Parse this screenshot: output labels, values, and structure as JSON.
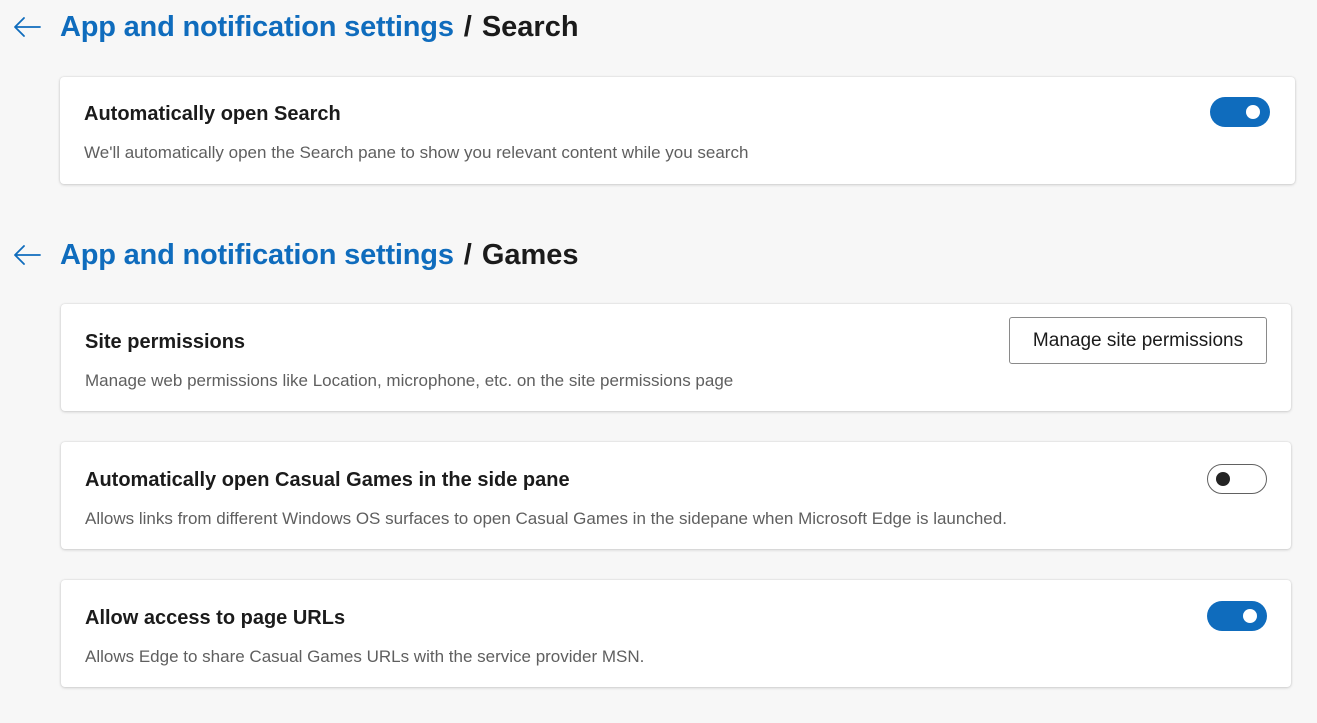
{
  "sections": [
    {
      "breadcrumb_link": "App and notification settings",
      "breadcrumb_sep": "/",
      "breadcrumb_current": "Search",
      "cards": [
        {
          "title": "Automatically open Search",
          "description": "We'll automatically open the Search pane to show you relevant content while you search",
          "toggle_state": "on"
        }
      ]
    },
    {
      "breadcrumb_link": "App and notification settings",
      "breadcrumb_sep": "/",
      "breadcrumb_current": "Games",
      "cards": [
        {
          "title": "Site permissions",
          "description": "Manage web permissions like Location, microphone, etc. on the site permissions page",
          "button_label": "Manage site permissions"
        },
        {
          "title": "Automatically open Casual Games in the side pane",
          "description": "Allows links from different Windows OS surfaces to open Casual Games in the sidepane when Microsoft Edge is launched.",
          "toggle_state": "off"
        },
        {
          "title": "Allow access to page URLs",
          "description": "Allows Edge to share Casual Games URLs with the service provider MSN.",
          "toggle_state": "on"
        }
      ]
    }
  ],
  "icons": {
    "back": "arrow-left-icon"
  },
  "colors": {
    "accent": "#0f6cbd",
    "background": "#f7f7f7",
    "card": "#ffffff",
    "text": "#1b1b1b",
    "secondary_text": "#5f5f5f"
  }
}
